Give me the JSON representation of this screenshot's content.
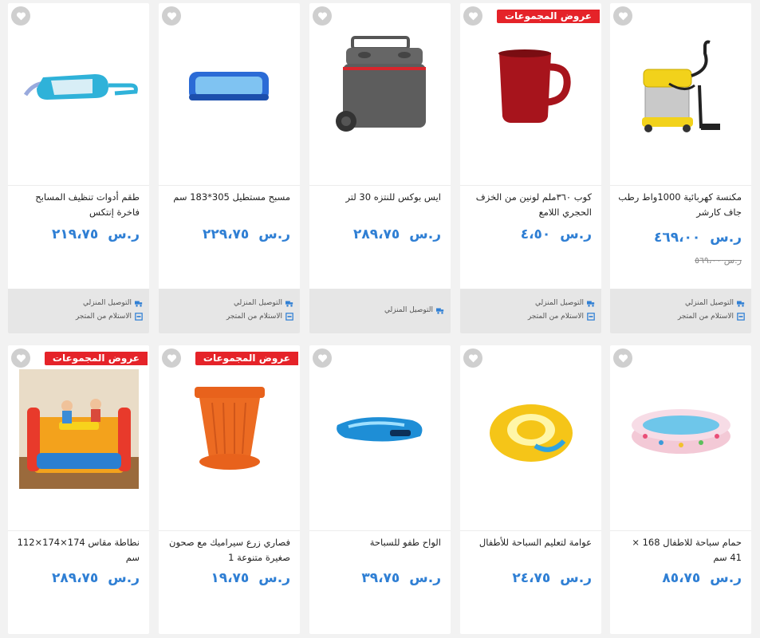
{
  "currency": "ر.س",
  "labels": {
    "badge": "عروض المجموعات",
    "home_delivery": "التوصيل المنزلي",
    "store_pickup": "الاستلام من المتجر"
  },
  "colors": {
    "price": "#2f7fd4",
    "badge_bg": "#e52329",
    "footer_bg": "#e6e6e6"
  },
  "products": [
    {
      "title": "مكنسة كهربائية 1000واط رطب جاف كارشر",
      "price": "٤٦٩،٠٠",
      "old_price": "٥٦٩،٠٠",
      "currency": "ر.س",
      "badge": "",
      "delivery": "التوصيل المنزلي",
      "pickup": "الاستلام من المتجر",
      "icon": "vacuum-cleaner-icon"
    },
    {
      "title": "كوب ٣٦٠ملم لونين من الخزف الحجري اللامع",
      "price": "٤،٥٠",
      "old_price": "",
      "currency": "ر.س",
      "badge": "عروض المجموعات",
      "delivery": "التوصيل المنزلي",
      "pickup": "الاستلام من المتجر",
      "icon": "mug-icon"
    },
    {
      "title": "ايس بوكس للنتزه 30 لتر",
      "price": "٢٨٩،٧٥",
      "old_price": "",
      "currency": "ر.س",
      "badge": "",
      "delivery": "التوصيل المنزلي",
      "pickup": "",
      "icon": "cooler-box-icon"
    },
    {
      "title": "مسبح مستطيل 305*183 سم",
      "price": "٢٢٩،٧٥",
      "old_price": "",
      "currency": "ر.س",
      "badge": "",
      "delivery": "التوصيل المنزلي",
      "pickup": "الاستلام من المتجر",
      "icon": "pool-icon"
    },
    {
      "title": "طقم أدوات تنظيف المسابح فاخرة إنتكس",
      "price": "٢١٩،٧٥",
      "old_price": "",
      "currency": "ر.س",
      "badge": "",
      "delivery": "التوصيل المنزلي",
      "pickup": "الاستلام من المتجر",
      "icon": "pool-vacuum-icon"
    },
    {
      "title": "حمام سباحة للاطفال 168 × 41 سم",
      "price": "٨٥،٧٥",
      "old_price": "",
      "currency": "ر.س",
      "badge": "",
      "delivery": "",
      "pickup": "",
      "icon": "kids-pool-icon"
    },
    {
      "title": "عوامة لتعليم السباحة للأطفال",
      "price": "٢٤،٧٥",
      "old_price": "",
      "currency": "ر.س",
      "badge": "",
      "delivery": "",
      "pickup": "",
      "icon": "swim-ring-icon"
    },
    {
      "title": "الواح طفو للسباحة",
      "price": "٣٩،٧٥",
      "old_price": "",
      "currency": "ر.س",
      "badge": "",
      "delivery": "",
      "pickup": "",
      "icon": "float-board-icon"
    },
    {
      "title": "فصاري زرع سيراميك مع صحون صغيرة متنوعة 1",
      "price": "١٩،٧٥",
      "old_price": "",
      "currency": "ر.س",
      "badge": "عروض المجموعات",
      "delivery": "",
      "pickup": "",
      "icon": "flower-pot-icon"
    },
    {
      "title": "نطاطة مقاس 174×174×112 سم",
      "price": "٢٨٩،٧٥",
      "old_price": "",
      "currency": "ر.س",
      "badge": "عروض المجموعات",
      "delivery": "",
      "pickup": "",
      "icon": "bounce-house-icon"
    }
  ]
}
